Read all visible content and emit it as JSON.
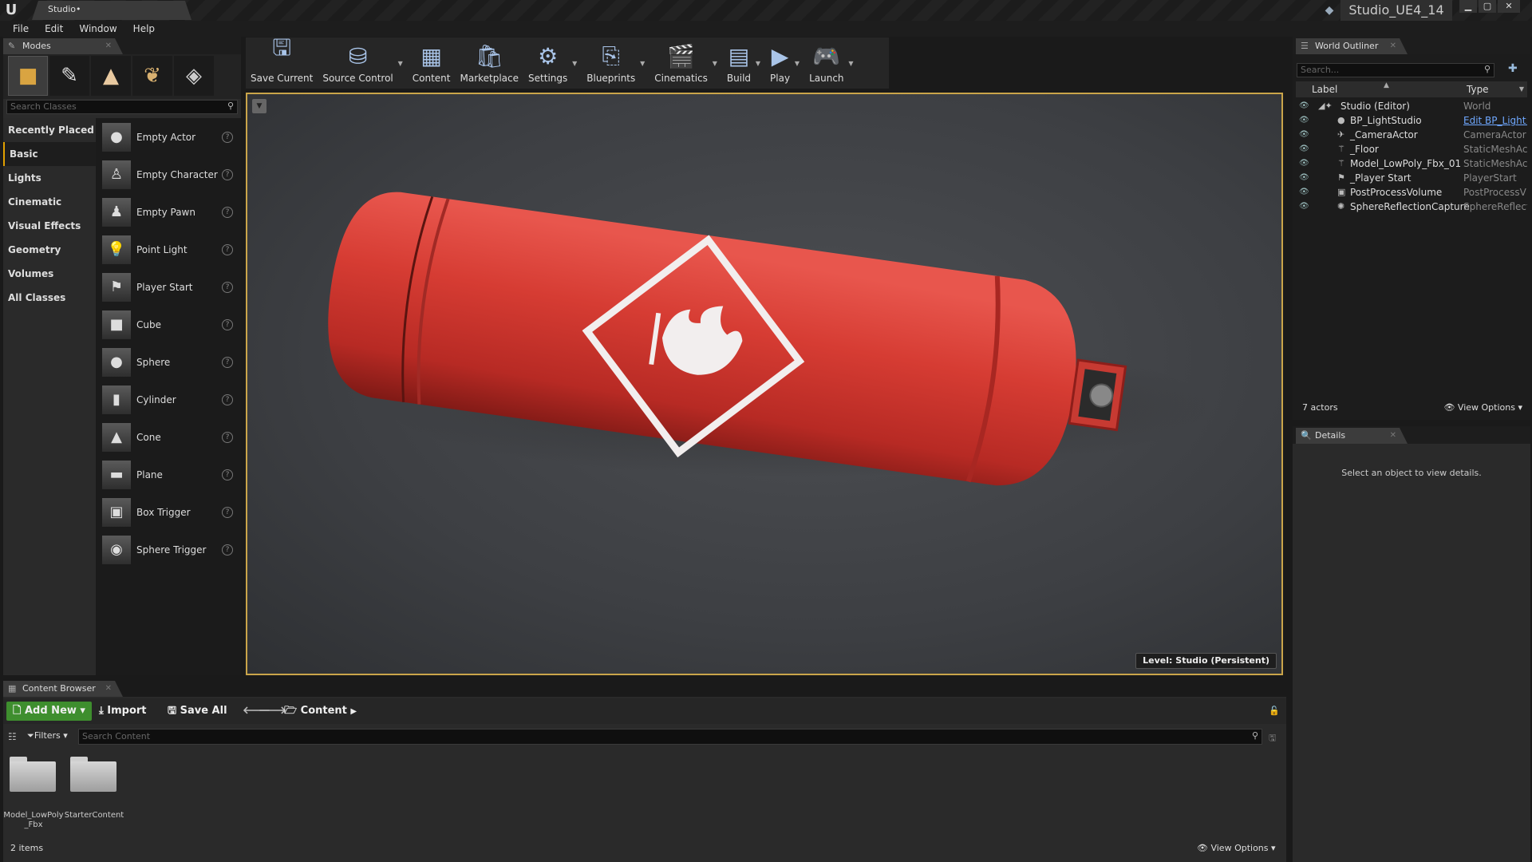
{
  "title_bar": {
    "tab": "Studio•",
    "project": "Studio_UE4_14"
  },
  "menu": [
    "File",
    "Edit",
    "Window",
    "Help"
  ],
  "modes": {
    "tab_label": "Modes",
    "search_placeholder": "Search Classes",
    "categories": [
      "Recently Placed",
      "Basic",
      "Lights",
      "Cinematic",
      "Visual Effects",
      "Geometry",
      "Volumes",
      "All Classes"
    ],
    "active_category": "Basic",
    "items": [
      "Empty Actor",
      "Empty Character",
      "Empty Pawn",
      "Point Light",
      "Player Start",
      "Cube",
      "Sphere",
      "Cylinder",
      "Cone",
      "Plane",
      "Box Trigger",
      "Sphere Trigger"
    ]
  },
  "toolbar": {
    "save": "Save Current",
    "source_control": "Source Control",
    "content": "Content",
    "marketplace": "Marketplace",
    "settings": "Settings",
    "blueprints": "Blueprints",
    "cinematics": "Cinematics",
    "build": "Build",
    "play": "Play",
    "launch": "Launch"
  },
  "viewport": {
    "level_label": "Level:",
    "level_name": "Studio (Persistent)"
  },
  "outliner": {
    "tab_label": "World Outliner",
    "search_placeholder": "Search...",
    "col_label": "Label",
    "col_type": "Type",
    "rows": [
      {
        "label": "Studio (Editor)",
        "type": "World"
      },
      {
        "label": "BP_LightStudio",
        "type": "Edit BP_Light:"
      },
      {
        "label": "_CameraActor",
        "type": "CameraActor"
      },
      {
        "label": "_Floor",
        "type": "StaticMeshAct"
      },
      {
        "label": "Model_LowPoly_Fbx_01",
        "type": "StaticMeshAct"
      },
      {
        "label": "_Player Start",
        "type": "PlayerStart"
      },
      {
        "label": "PostProcessVolume",
        "type": "PostProcessV"
      },
      {
        "label": "SphereReflectionCapture",
        "type": "SphereReflecti"
      }
    ],
    "count": "7 actors",
    "view_options": "View Options"
  },
  "details": {
    "tab_label": "Details",
    "empty_message": "Select an object to view details."
  },
  "content_browser": {
    "tab_label": "Content Browser",
    "add_new": "Add New",
    "import": "Import",
    "save_all": "Save All",
    "path": "Content",
    "filters": "Filters",
    "search_placeholder": "Search Content",
    "folders": [
      "Model_LowPoly _Fbx",
      "StarterContent"
    ],
    "count": "2 items",
    "view_options": "View Options"
  }
}
